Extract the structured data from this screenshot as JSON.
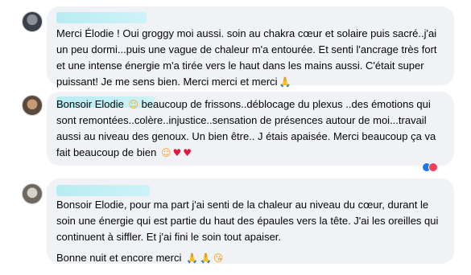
{
  "comments": [
    {
      "text": "Merci Élodie ! Oui groggy moi aussi. soin au chakra cœur et solaire puis sacré..j'ai un peu dormi...puis une vague de chaleur m'a entourée. Et senti l'ancrage très fort et une intense énergie m'a tirée vers le haut dans les mains aussi. C'était super puissant! Je me sens bien. Merci merci et merci",
      "emojis": [
        "pray-emoji"
      ]
    },
    {
      "text": "Bonsoir Elodie",
      "text_cont": "beaucoup de frissons..déblocage du plexus ..des émotions qui sont remontées..colère..injustice..sensation de présences autour de moi...travail aussi au niveau des genoux. Un bien être.. J étais apaisée. Merci beaucoup ça va fait beaucoup de bien",
      "emojis": [
        "smiling-face-emoji",
        "red-heart-emoji",
        "red-heart-emoji"
      ],
      "reaction_colors": [
        "#1877f2",
        "#f33e58"
      ]
    },
    {
      "lines": [
        "Bonsoir Elodie, pour ma part j'ai senti de la chaleur au niveau du cœur, durant le soin une énergie qui est partie du haut des épaules vers la tête. J'ai les oreilles qui continuent à siffler. Et j'ai fini le soin tout apaiser.",
        "Bonne nuit et encore merci"
      ],
      "emojis": [
        "pray-emoji",
        "pray-emoji",
        "kissing-face-emoji"
      ]
    }
  ],
  "colors": {
    "bubble": "#f0f2f5",
    "author_redaction": "#b7ecf3",
    "text": "#050505"
  }
}
